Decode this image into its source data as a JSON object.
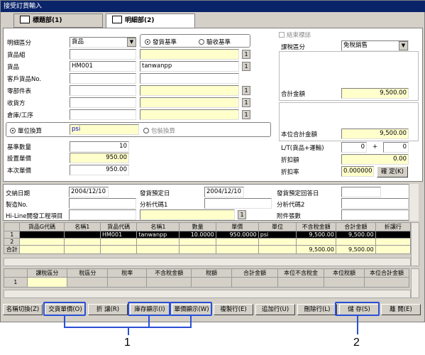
{
  "window": {
    "title": "接受訂貨輸入"
  },
  "tabs": [
    {
      "label": "標題部(1)"
    },
    {
      "label": "明細部(2)"
    }
  ],
  "form": {
    "detail_type_label": "明細區分",
    "detail_type_value": "貨品",
    "radio_issue": "發貨基準",
    "radio_acceptance": "驗收基準",
    "goods_group_label": "貨品組",
    "goods_label": "貨品",
    "goods_code": "HM001",
    "goods_name": "tanwanpp",
    "customer_goods_label": "客戶貨品No.",
    "parts_table_label": "零部件表",
    "receiver_label": "收貨方",
    "warehouse_label": "倉庫/工序",
    "unit_conv_radio": "單位換算",
    "unit_value": "psi",
    "package_conv": "包裝換算",
    "base_qty_label": "基準數量",
    "base_qty_value": "10",
    "set_price_label": "設置單價",
    "set_price_value": "950.00",
    "this_price_label": "本次單價",
    "this_price_value": "950.00",
    "closed_flag": "結束標誌",
    "tax_type_label": "課稅區分",
    "tax_type_value": "免稅銷售",
    "total_amount_label": "合計金額",
    "total_amount_value": "9,500.00",
    "unit_total_label": "本位合計金額",
    "unit_total_value": "9,500.00",
    "lt_label": "L/T(貨品+運輸)",
    "lt_value1": "0",
    "lt_plus": "+",
    "lt_value2": "0",
    "discount_label": "折扣額",
    "discount_value": "0.00",
    "discount_rate_label": "折扣率",
    "discount_rate_value": "0.000000",
    "confirm_button": "確 定(K)"
  },
  "schedule": {
    "delivery_date_label": "交納日期",
    "delivery_date_value": "2004/12/10",
    "ship_plan_label": "發貨預定日",
    "ship_plan_value": "2004/12/10",
    "ship_plan_reply_label": "發貨預定回答日",
    "mfg_no_label": "製造No.",
    "analysis1_label": "分析代碼1",
    "analysis2_label": "分析代碼2",
    "hiline_label": "Hi-Line開發工程項目",
    "attachments_label": "附件張數"
  },
  "grid1": {
    "headers": [
      "",
      "貨品G代碼",
      "名稱1",
      "貨品代碼",
      "名稱1",
      "數量",
      "單價",
      "單位",
      "不含稅金額",
      "合計金額",
      "折讓行"
    ],
    "rows": [
      [
        "1",
        "",
        "",
        "HM001",
        "tanwanpp",
        "10.0000",
        "950.0000",
        "psi",
        "9,500.00",
        "9,500.00",
        ""
      ],
      [
        "2",
        "",
        "",
        "",
        "",
        "",
        "",
        "",
        "",
        "",
        ""
      ]
    ],
    "total_label": "合計",
    "total_excl": "9,500.00",
    "total_sum": "9,500.00"
  },
  "grid2": {
    "headers": [
      "",
      "課稅區分",
      "稅區分",
      "稅率",
      "不含稅金額",
      "稅額",
      "合計金額",
      "本位不含稅金",
      "本位稅額",
      "本位合計金額"
    ],
    "rows": [
      [
        "1",
        "",
        "",
        "",
        "",
        "",
        "",
        "",
        "",
        ""
      ]
    ]
  },
  "buttons": [
    "名稱切換(Z)",
    "交貨單價(O)",
    "折 讓(R)",
    "庫存顯示(I)",
    "單價顯示(W)",
    "複製行(E)",
    "追加行(U)",
    "刪除行(L)",
    "儲 存(S)",
    "離 開(E)"
  ],
  "callouts": [
    "1",
    "2"
  ]
}
